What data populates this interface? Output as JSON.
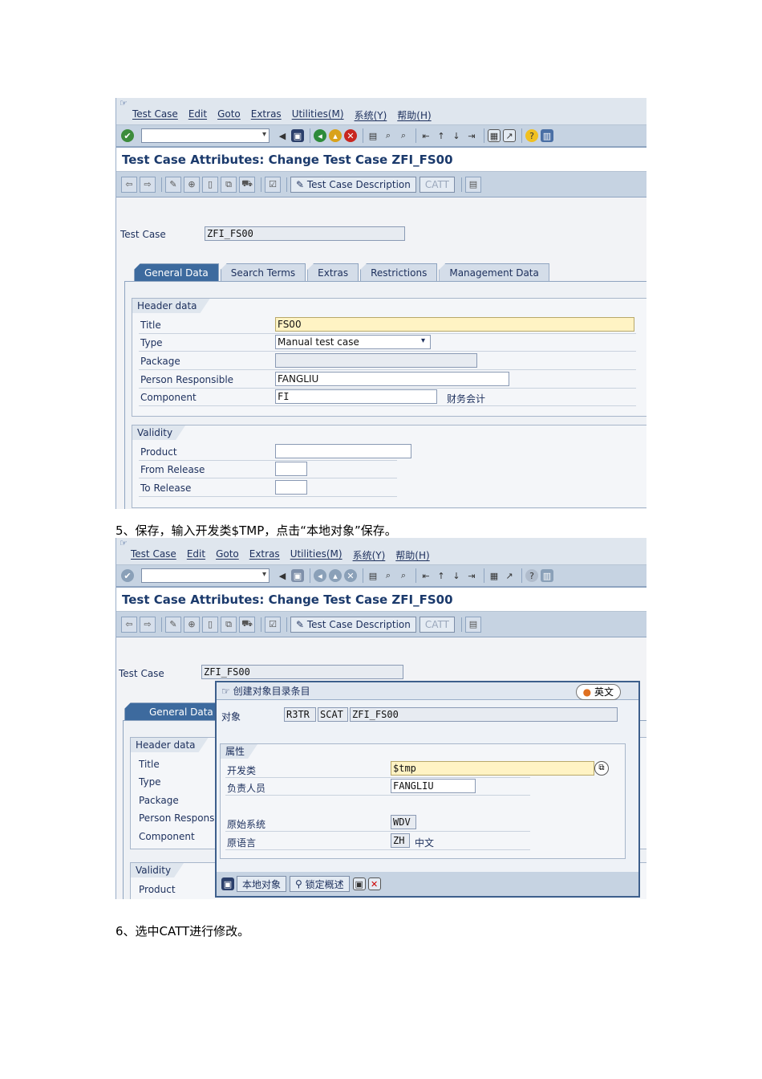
{
  "shot1": {
    "menu": [
      "Test Case",
      "Edit",
      "Goto",
      "Extras",
      "Utilities(M)",
      "系统(Y)",
      "帮助(H)"
    ],
    "title": "Test Case Attributes: Change Test Case ZFI_FS00",
    "app_buttons": {
      "desc": "Test Case Description",
      "catt": "CATT"
    },
    "test_case_label": "Test Case",
    "test_case_value": "ZFI_FS00",
    "tabs": [
      "General Data",
      "Search Terms",
      "Extras",
      "Restrictions",
      "Management Data"
    ],
    "header_group": "Header data",
    "fields": {
      "title_l": "Title",
      "title_v": "FS00",
      "type_l": "Type",
      "type_v": "Manual test case",
      "package_l": "Package",
      "person_l": "Person Responsible",
      "person_v": "FANGLIU",
      "comp_l": "Component",
      "comp_v": "FI",
      "comp_desc": "财务会计"
    },
    "validity_group": "Validity",
    "validity": {
      "product": "Product",
      "from": "From Release",
      "to": "To Release"
    }
  },
  "step5": "5、保存，输入开发类$TMP，点击“本地对象”保存。",
  "shot2": {
    "menu": [
      "Test Case",
      "Edit",
      "Goto",
      "Extras",
      "Utilities(M)",
      "系统(Y)",
      "帮助(H)"
    ],
    "title": "Test Case Attributes: Change Test Case ZFI_FS00",
    "app_buttons": {
      "desc": "Test Case Description",
      "catt": "CATT"
    },
    "test_case_label": "Test Case",
    "test_case_value": "ZFI_FS00",
    "tab_active": "General Data",
    "header_group": "Header data",
    "left_labels": [
      "Title",
      "Type",
      "Package",
      "Person Responsib",
      "Component"
    ],
    "validity_group": "Validity",
    "product": "Product",
    "dialog": {
      "title": "创建对象目录条目",
      "ime": "英文",
      "obj_label": "对象",
      "obj1": "R3TR",
      "obj2": "SCAT",
      "obj3": "ZFI_FS00",
      "attr_group": "属性",
      "dev_l": "开发类",
      "dev_v": "$tmp",
      "resp_l": "负责人员",
      "resp_v": "FANGLIU",
      "orig_l": "原始系统",
      "orig_v": "WDV",
      "lang_l": "原语言",
      "lang_v": "ZH",
      "lang_desc": "中文",
      "btn_local": "本地对象",
      "btn_lock": "锁定概述"
    }
  },
  "step6": "6、选中CATT进行修改。"
}
